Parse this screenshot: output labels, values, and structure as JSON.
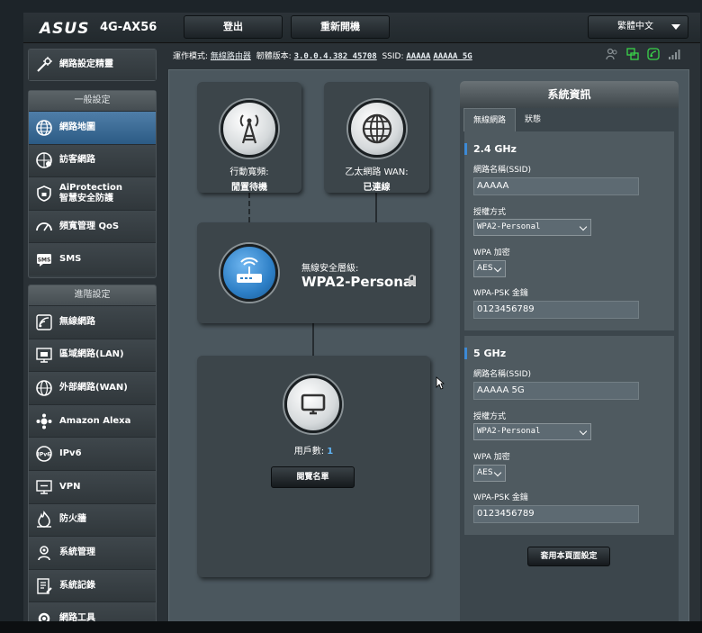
{
  "header": {
    "logo": "ASUS",
    "model": "4G-AX56",
    "logout_label": "登出",
    "reboot_label": "重新開機",
    "language": "繁體中文"
  },
  "status": {
    "mode_label": "運作模式:",
    "mode_value": "無線路由器",
    "firmware_label": "韌體版本:",
    "firmware_value": "3.0.0.4.382_45708",
    "ssid_label": "SSID:",
    "ssid_24": "AAAAA",
    "ssid_5": "AAAAA_5G"
  },
  "sidebar": {
    "wizard": "網路設定精靈",
    "general_header": "一般設定",
    "general_items": [
      {
        "label": "網路地圖",
        "icon": "globe-map-icon"
      },
      {
        "label": "訪客網路",
        "icon": "guest-network-icon"
      },
      {
        "label": "AiProtection",
        "label2": "智慧安全防護",
        "icon": "shield-lock-icon"
      },
      {
        "label": "頻寬管理 QoS",
        "icon": "speedometer-icon"
      },
      {
        "label": "SMS",
        "icon": "sms-icon"
      }
    ],
    "advanced_header": "進階設定",
    "advanced_items": [
      {
        "label": "無線網路",
        "icon": "wifi-icon"
      },
      {
        "label": "區域網路(LAN)",
        "icon": "lan-icon"
      },
      {
        "label": "外部網路(WAN)",
        "icon": "wan-globe-icon"
      },
      {
        "label": "Amazon Alexa",
        "icon": "alexa-icon"
      },
      {
        "label": "IPv6",
        "icon": "ipv6-icon"
      },
      {
        "label": "VPN",
        "icon": "vpn-icon"
      },
      {
        "label": "防火牆",
        "icon": "firewall-icon"
      },
      {
        "label": "系統管理",
        "icon": "admin-gear-icon"
      },
      {
        "label": "系統記錄",
        "icon": "log-icon"
      },
      {
        "label": "網路工具",
        "icon": "tools-icon"
      }
    ]
  },
  "map": {
    "mobile_label": "行動寬頻:",
    "mobile_value": "閒置待機",
    "wan_label": "乙太網路 WAN:",
    "wan_value": "已連線",
    "security_label": "無線安全層級:",
    "security_value": "WPA2-Personal",
    "clients_label": "用戶數:",
    "clients_count": "1",
    "view_list": "閱覽名單"
  },
  "sysinfo": {
    "title": "系統資訊",
    "tab_wireless": "無線網路",
    "tab_status": "狀態",
    "ssid_label": "網路名稱(SSID)",
    "auth_label": "授權方式",
    "wpa_label": "WPA 加密",
    "psk_label": "WPA-PSK 金鑰",
    "band24": {
      "title": "2.4 GHz",
      "ssid": "AAAAA",
      "auth": "WPA2-Personal",
      "enc": "AES",
      "psk": "0123456789"
    },
    "band5": {
      "title": "5 GHz",
      "ssid": "AAAAA 5G",
      "auth": "WPA2-Personal",
      "enc": "AES",
      "psk": "0123456789"
    },
    "apply": "套用本頁面設定"
  }
}
